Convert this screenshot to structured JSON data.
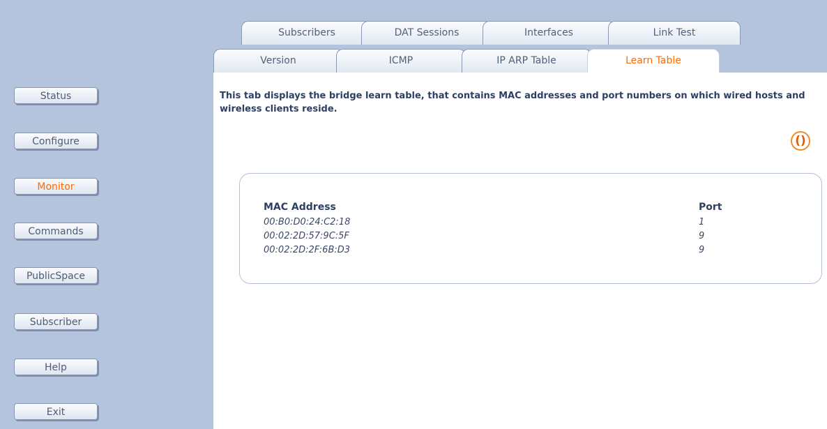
{
  "tabs": {
    "row1": [
      "Subscribers",
      "DAT Sessions",
      "Interfaces",
      "Link Test"
    ],
    "row2": [
      "Version",
      "ICMP",
      "IP ARP Table",
      "Learn Table"
    ]
  },
  "sidebar": {
    "items": [
      {
        "label": "Status"
      },
      {
        "label": "Configure"
      },
      {
        "label": "Monitor"
      },
      {
        "label": "Commands"
      },
      {
        "label": "PublicSpace"
      },
      {
        "label": "Subscriber"
      },
      {
        "label": "Help"
      },
      {
        "label": "Exit"
      }
    ]
  },
  "main": {
    "description": "This tab displays the bridge learn table, that contains MAC addresses and port numbers on which wired hosts and wireless clients reside.",
    "table": {
      "headers": [
        "MAC Address",
        "Port"
      ],
      "rows": [
        {
          "mac": "00:B0:D0:24:C2:18",
          "port": "1"
        },
        {
          "mac": "00:02:2D:57:9C:5F",
          "port": "9"
        },
        {
          "mac": "00:02:2D:2F:6B:D3",
          "port": "9"
        }
      ]
    },
    "refresh_icon": "refresh-icon",
    "refresh_glyph": "()"
  },
  "colors": {
    "sidebar_bg": "#b5c4dd",
    "active_accent": "#ff6a00"
  }
}
